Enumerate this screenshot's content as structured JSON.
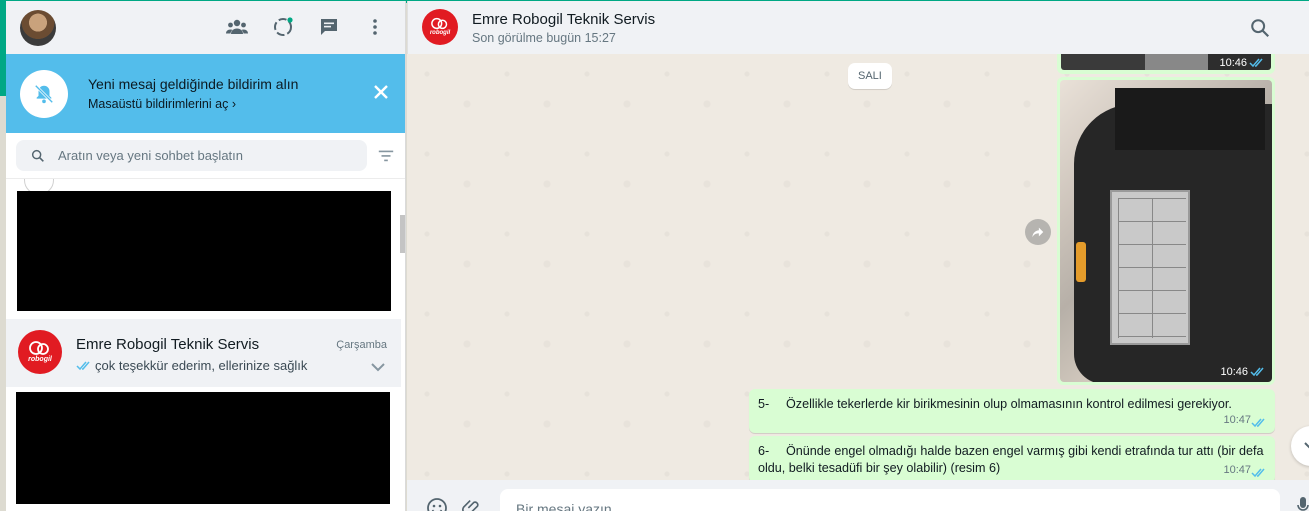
{
  "sidebar": {
    "notification": {
      "title": "Yeni mesaj geldiğinde bildirim alın",
      "subtitle": "Masaüstü bildirimlerini aç"
    },
    "search": {
      "placeholder": "Aratın veya yeni sohbet başlatın"
    },
    "chats": [
      {
        "name": "Emre Robogil Teknik Servis",
        "time": "Çarşamba",
        "preview": "çok teşekkür ederim, ellerinize sağlık",
        "avatar_text": "robogil"
      }
    ]
  },
  "conversation": {
    "contact_name": "Emre Robogil Teknik Servis",
    "contact_status": "Son görülme bugün 15:27",
    "avatar_text": "robogil",
    "date_chip": "SALI",
    "image_messages": [
      {
        "time": "10:46"
      },
      {
        "time": "10:46"
      }
    ],
    "text_messages": [
      {
        "number": "5-",
        "text": "Özellikle tekerlerde kir birikmesinin olup olmamasının kontrol edilmesi gerekiyor.",
        "time": "10:47"
      },
      {
        "number": "6-",
        "text": "Önünde engel olmadığı halde bazen engel varmış gibi kendi etrafında tur attı (bir defa oldu, belki tesadüfi bir şey olabilir) (resim 6)",
        "time": "10:47"
      }
    ],
    "composer": {
      "placeholder": "Bir mesaj yazın"
    }
  },
  "colors": {
    "accent": "#00a884",
    "notification_bg": "#53bdeb",
    "outgoing_bubble": "#d9fdd3",
    "read_check": "#53bdeb",
    "brand_red": "#e11b22"
  }
}
